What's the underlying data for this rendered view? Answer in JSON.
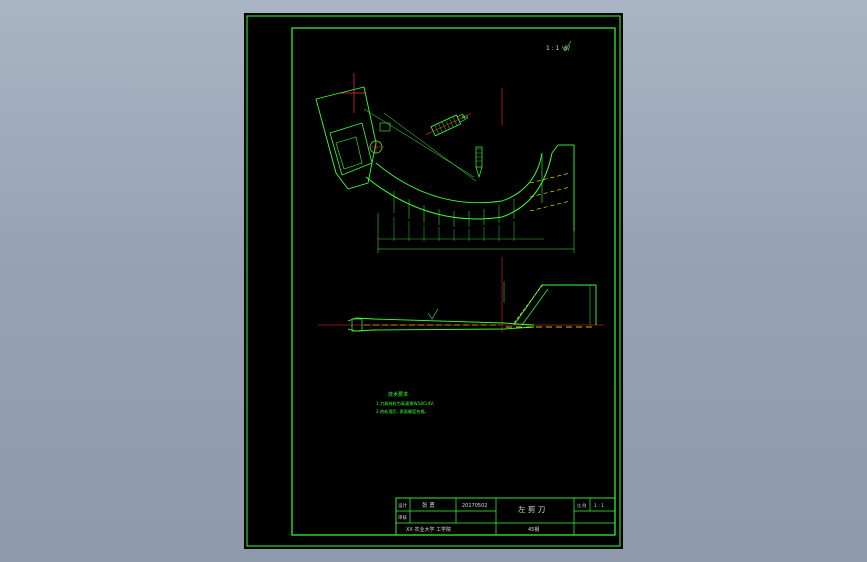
{
  "drawing": {
    "scale_note": "1 : 1",
    "surface_mark": "6/",
    "colors": {
      "background": "#000000",
      "frame": "#39ff39",
      "center_line": "#ff3030",
      "hidden_line": "#ffff00",
      "title_block_text": "#d8d8d8"
    }
  },
  "notes": {
    "heading": "技术要求",
    "line1": "1.刀具材料为高速钢W18Cr4V;",
    "line2": "2.热处理后, 表面硬度合格。"
  },
  "title_block": {
    "cell_label_design": "设计",
    "cell_label_review": "审核",
    "designer": "张 勇",
    "drawing_no": "20170502",
    "part_name": "左 剪 刀",
    "scale_label": "比 例",
    "scale_value": "1 : 1",
    "school": "XX 农业大学 工学院",
    "material": "45钢"
  }
}
